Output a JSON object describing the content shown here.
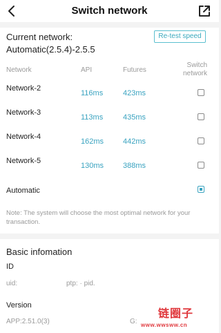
{
  "header": {
    "title": "Switch network"
  },
  "current": {
    "label": "Current network:",
    "value": "Automatic(2.5.4)-2.5.5",
    "retest_label": "Re-test speed"
  },
  "table": {
    "headers": {
      "network": "Network",
      "api": "API",
      "futures": "Futures",
      "switch": "Switch network"
    },
    "rows": [
      {
        "name": "Network-2",
        "api": "116ms",
        "futures": "423ms",
        "selected": false
      },
      {
        "name": "Network-3",
        "api": "113ms",
        "futures": "435ms",
        "selected": false
      },
      {
        "name": "Network-4",
        "api": "162ms",
        "futures": "442ms",
        "selected": false
      },
      {
        "name": "Network-5",
        "api": "130ms",
        "futures": "388ms",
        "selected": false
      }
    ],
    "automatic": {
      "label": "Automatic",
      "selected": true
    }
  },
  "note": "Note: The system will choose the most optimal network for your transaction.",
  "basic": {
    "title": "Basic infomation",
    "id_label": "ID",
    "uid": "uid:",
    "ptp": "ptp: · pid.",
    "version_label": "Version",
    "app_version": "APP:2.51.0(3)",
    "g_label": "G:"
  },
  "watermark": {
    "logo": "链圈子",
    "url": "www.wwsww.cn"
  },
  "colors": {
    "accent": "#3aa3c0",
    "watermark": "#e0393e"
  }
}
